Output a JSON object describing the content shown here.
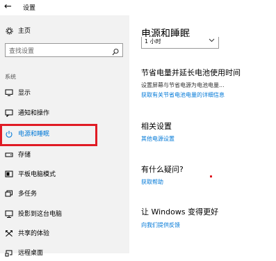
{
  "window": {
    "title": "设置"
  },
  "sidebar": {
    "home_label": "主页",
    "search_placeholder": "查找设置",
    "section_label": "系统",
    "items": [
      {
        "label": "显示",
        "icon": "monitor-icon"
      },
      {
        "label": "通知和操作",
        "icon": "notification-icon"
      },
      {
        "label": "电源和睡眠",
        "icon": "power-icon",
        "active": true
      },
      {
        "label": "存储",
        "icon": "storage-icon"
      },
      {
        "label": "平板电脑模式",
        "icon": "tablet-mode-icon"
      },
      {
        "label": "多任务",
        "icon": "multitasking-icon"
      },
      {
        "label": "投影到这台电脑",
        "icon": "project-icon"
      },
      {
        "label": "共享的体验",
        "icon": "shared-experiences-icon"
      },
      {
        "label": "远程桌面",
        "icon": "remote-desktop-icon"
      }
    ]
  },
  "main": {
    "title": "电源和睡眠",
    "dropdown_value": "1 小时",
    "save_power": {
      "heading": "节省电量并延长电池使用时间",
      "description": "设置屏幕与节省电源为电池电量...",
      "link": "获取有关节省电池电量的详细信息"
    },
    "related": {
      "heading": "相关设置",
      "link": "其他电源设置"
    },
    "question": {
      "heading": "有什么疑问?",
      "link": "获取帮助"
    },
    "improve": {
      "heading": "让 Windows 变得更好",
      "link": "向我们提供反馈"
    }
  },
  "colors": {
    "accent": "#0078d7",
    "highlight_box": "#e01b24",
    "sidebar_bg": "#f2f2f2"
  }
}
